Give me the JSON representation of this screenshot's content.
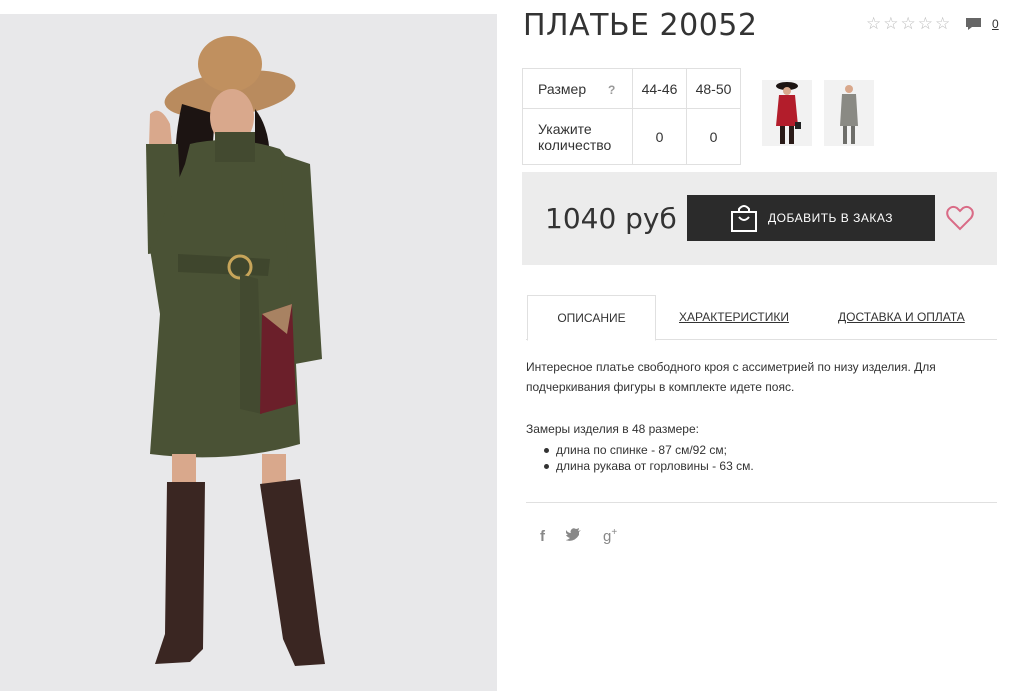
{
  "product": {
    "title": "ПЛАТЬЕ 20052",
    "rating_stars": 0,
    "rating_max": 5,
    "comment_count": "0"
  },
  "size_table": {
    "size_label": "Размер",
    "help_mark": "?",
    "sizes": [
      "44-46",
      "48-50"
    ],
    "quantity_label": "Укажите количество",
    "quantities": [
      "0",
      "0"
    ]
  },
  "purchase": {
    "price": "1040 руб",
    "order_button": "ДОБАВИТЬ В ЗАКАЗ"
  },
  "tabs": [
    {
      "label": "ОПИСАНИЕ",
      "active": true
    },
    {
      "label": "ХАРАКТЕРИСТИКИ",
      "active": false
    },
    {
      "label": "ДОСТАВКА И ОПЛАТА",
      "active": false
    }
  ],
  "description": {
    "text": "Интересное платье свободного кроя с ассиметрией по низу изделия. Для подчеркивания фигуры в комплекте идете пояс.",
    "measures_title": "Замеры изделия в 48 размере:",
    "measures": [
      "длина по спинке - 87 см/92 см;",
      "длина рукава от горловины - 63 см."
    ]
  },
  "social": [
    "facebook-icon",
    "twitter-icon",
    "google-plus-icon"
  ],
  "colors": {
    "button_bg": "#2b2b2b",
    "price_box_bg": "#ececec",
    "heart": "#d96b86",
    "dress": "#4a5235"
  }
}
